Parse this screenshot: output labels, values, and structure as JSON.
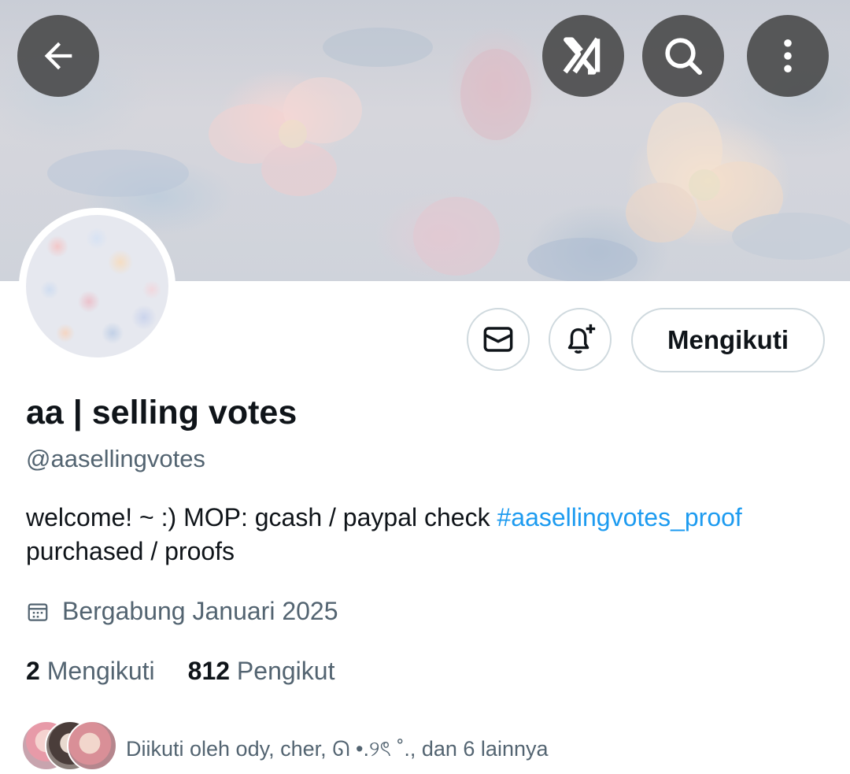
{
  "header": {
    "back_icon": "arrow-left-icon",
    "grok_icon": "grok-icon",
    "search_icon": "search-icon",
    "more_icon": "more-vertical-icon"
  },
  "actions": {
    "message_icon": "envelope-icon",
    "notify_icon": "bell-plus-icon",
    "follow_label": "Mengikuti"
  },
  "profile": {
    "display_name": "aa | selling votes",
    "handle": "@aasellingvotes",
    "bio_text": "welcome! ~ :) MOP: gcash / paypal check ",
    "bio_hashtag": "#aasellingvotes_proof",
    "bio_text_2": "purchased / proofs",
    "joined": "Bergabung Januari 2025"
  },
  "stats": {
    "following_count": "2",
    "following_label": "Mengikuti",
    "followers_count": "812",
    "followers_label": "Pengikut"
  },
  "followed_by": {
    "text": "Diikuti oleh ody, cher, ᘏ •.୨ৎ ˚., dan 6 lainnya"
  },
  "colors": {
    "text_primary": "#0f1419",
    "text_secondary": "#536471",
    "link": "#1d9bf0",
    "border": "#cfd9de"
  }
}
